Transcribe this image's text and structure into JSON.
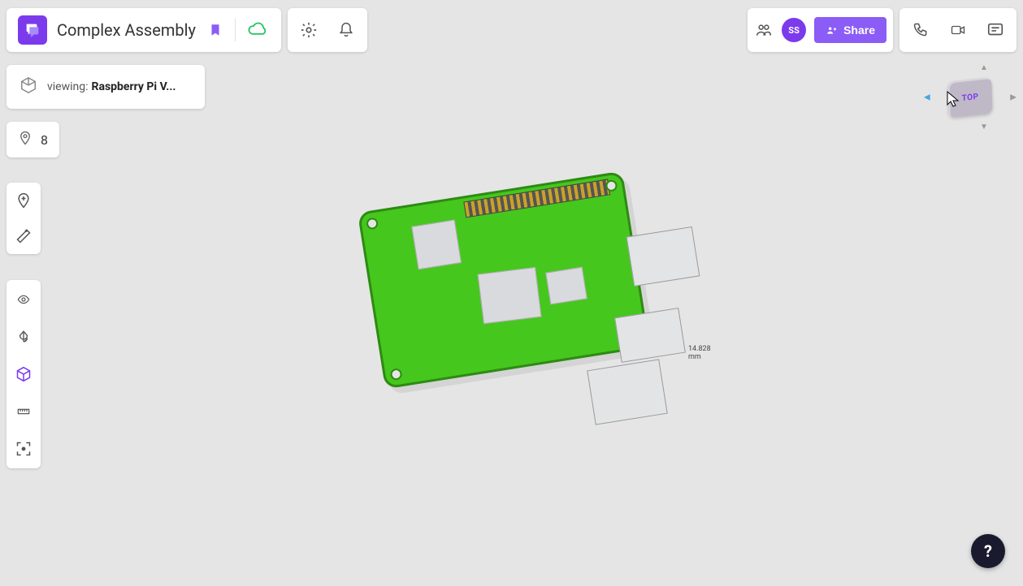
{
  "header": {
    "doc_title": "Complex Assembly",
    "avatar_initials": "SS",
    "share_label": "Share"
  },
  "viewing": {
    "prefix": "viewing:",
    "name": "Raspberry Pi V..."
  },
  "pins": {
    "count": "8"
  },
  "viewcube": {
    "face": "TOP"
  },
  "model": {
    "dimension_label": "14.828 mm"
  },
  "help": {
    "label": "?"
  },
  "colors": {
    "accent": "#7c3aed",
    "pcb": "#45c71d"
  }
}
